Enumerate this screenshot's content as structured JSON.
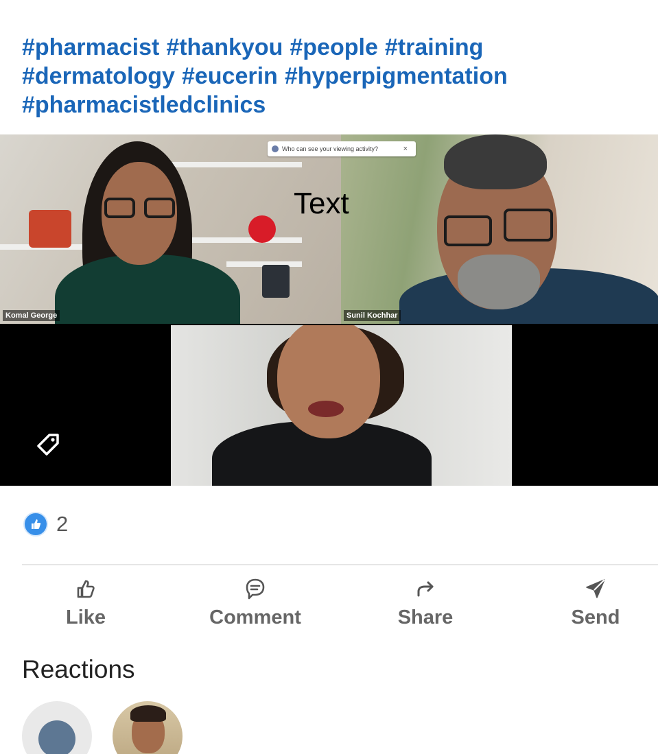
{
  "post": {
    "hashtags": [
      "#pharmacist",
      "#thankyou",
      "#people",
      "#training",
      "#dermatology",
      "#eucerin",
      "#hyperpigmentation",
      "#pharmacistledclinics"
    ]
  },
  "video": {
    "participants": [
      {
        "name": "Komal George"
      },
      {
        "name": "Sunil Kochhar"
      }
    ],
    "privacy_prompt": "Who can see your viewing activity?",
    "privacy_close": "×",
    "overlay_text": "Text"
  },
  "social": {
    "reaction_count": "2",
    "reaction_icon": "like-icon",
    "accent": "#378fe9"
  },
  "actions": {
    "like": "Like",
    "comment": "Comment",
    "share": "Share",
    "send": "Send"
  },
  "reactions_section": {
    "heading": "Reactions"
  }
}
